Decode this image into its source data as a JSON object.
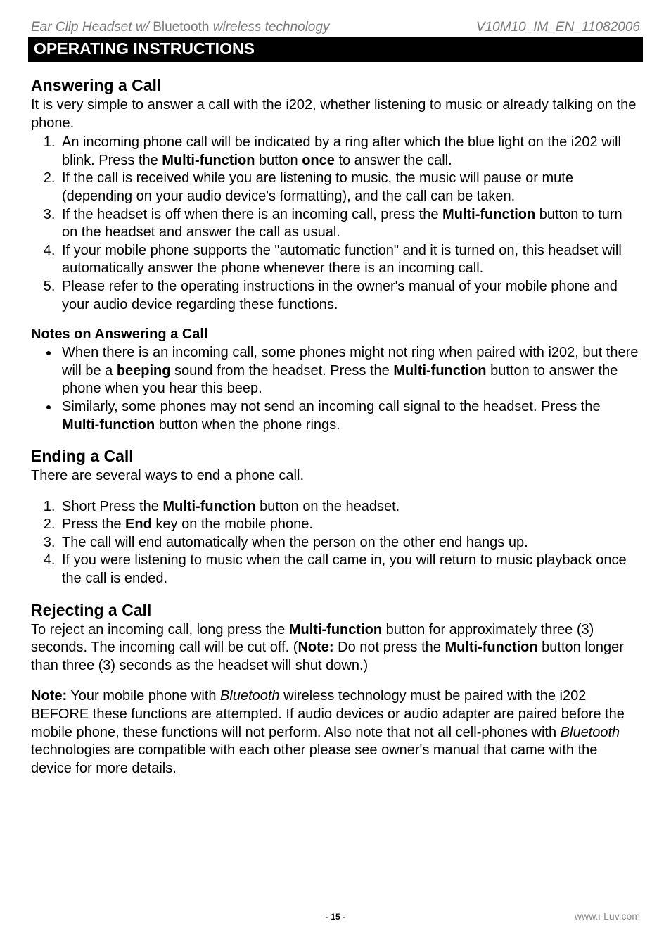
{
  "header": {
    "left_prefix": "Ear Clip Headset w/ ",
    "left_mid": "Bluetooth",
    "left_suffix": " wireless technology",
    "right": "V10M10_IM_EN_11082006"
  },
  "bar": "OPERATING INSTRUCTIONS",
  "s1": {
    "title": "Answering a Call",
    "lead": "It is very simple to answer a call with the i202, whether listening to music or already talking on the phone.",
    "items": [
      "An incoming phone call will be indicated by a ring after which the blue light on the i202 will blink. Press the <b>Multi-function</b> button <b>once</b> to answer the call.",
      "If the call is received while you are listening to music, the music will pause or mute (depending on your audio device's formatting), and the call can be taken.",
      "If the headset is off when there is an incoming call, press the <b>Multi-function</b> button to turn on the headset and answer the call as usual.",
      "If your mobile phone supports the \"automatic function\" and it is turned on, this headset will automatically answer the phone whenever there is an incoming call.",
      "Please refer to the operating instructions in the owner's manual of your mobile phone and your audio device regarding these functions."
    ],
    "notes_title": "Notes on Answering a Call",
    "notes": [
      "When there is an incoming call, some phones might not ring when paired with i202, but there will be a <b>beeping</b> sound from the headset. Press the <b>Multi-function</b> button to answer the phone when you hear this beep.",
      "Similarly, some phones may not send an incoming call signal to the headset. Press the <b>Multi-function</b> button when the phone rings."
    ]
  },
  "s2": {
    "title": "Ending a Call",
    "lead": "There are several ways to end a phone call.",
    "items": [
      "Short Press the <b>Multi-function</b> button on the headset.",
      "Press the <b>End</b> key on the mobile phone.",
      "The call will end automatically when the person on the other end hangs up.",
      "If you were listening to music when the call came in, you will return to music playback once the call is ended."
    ]
  },
  "s3": {
    "title": "Rejecting a Call",
    "p1": "To reject an incoming call, long press the <b>Multi-function</b> button for approximately three (3) seconds. The incoming call will be cut off. (<b>Note:</b> Do not press the <b>Multi-function</b> button longer than three (3) seconds as the headset will shut down.)",
    "p2": "<b>Note:</b> Your mobile phone with <span class=\"ital\">Bluetooth</span> wireless technology must be paired with the i202 BEFORE these functions are attempted. If audio devices or audio adapter are paired before the mobile phone, these functions will not perform. Also note that not all cell-phones with <span class=\"ital\">Bluetooth</span> technologies are compatible with each other please see owner's manual that came with the device for more details."
  },
  "footer": {
    "page": "- 15 -",
    "site": "www.i-Luv.com"
  }
}
